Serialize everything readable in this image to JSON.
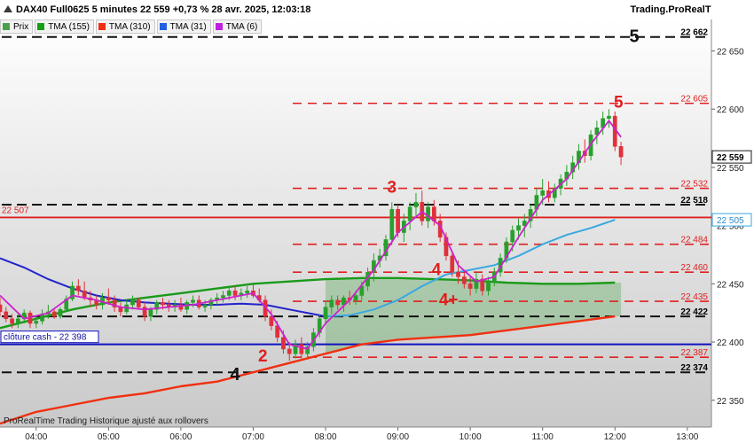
{
  "header": {
    "title": "DAX40 Full0625 5 minutes 22 559 +0,73 % 28 avr. 2025, 12:03:18",
    "brand": "Trading.ProRealTime.com"
  },
  "legend": [
    {
      "label": "Prix",
      "color": "#4aa04a"
    },
    {
      "label": "TMA (155)",
      "color": "#15a015"
    },
    {
      "label": "TMA (310)",
      "color": "#f03010"
    },
    {
      "label": "TMA (31)",
      "color": "#2060e0"
    },
    {
      "label": "TMA (6)",
      "color": "#c020e0"
    }
  ],
  "footer": "ProRealTime Trading  Historique ajusté aux rollovers",
  "colors": {
    "candle_up": "#27a02b",
    "candle_down": "#e0303a",
    "tma155": "#1a9a1a",
    "tma310": "#f03010",
    "tma31": "#2222cc",
    "tma31_late": "#3aa8e0",
    "tma6": "#cc22cc",
    "black_level": "#111111",
    "red_level": "#e02020",
    "cash_line": "#1010c0",
    "ref_line": "#e02020",
    "current_price_box": "#1a1a1a"
  },
  "chart_data": {
    "type": "candlestick",
    "instrument": "DAX40 Full0625",
    "timeframe": "5 minutes",
    "x_ticks": [
      "04:00",
      "05:00",
      "06:00",
      "07:00",
      "08:00",
      "09:00",
      "10:00",
      "11:00",
      "12:00",
      "13:00"
    ],
    "y_ticks": [
      22350,
      22400,
      22450,
      22500,
      22550,
      22600,
      22650
    ],
    "y_tick_labels": [
      "22 350",
      "22 400",
      "22 450",
      "22 500",
      "22 550",
      "22 600",
      "22 650"
    ],
    "ylim": [
      22327,
      22677
    ],
    "xlim": [
      "03:30",
      "13:20"
    ],
    "levels": [
      {
        "value": 22662,
        "label": "22 662",
        "color": "black",
        "style": "dashed"
      },
      {
        "value": 22605,
        "label": "22 605",
        "color": "red",
        "style": "dashed"
      },
      {
        "value": 22532,
        "label": "22 532",
        "color": "red",
        "style": "dashed"
      },
      {
        "value": 22518,
        "label": "22 518",
        "color": "black",
        "style": "dashed"
      },
      {
        "value": 22484,
        "label": "22 484",
        "color": "red",
        "style": "dashed"
      },
      {
        "value": 22460,
        "label": "22 460",
        "color": "red",
        "style": "dashed"
      },
      {
        "value": 22435,
        "label": "22 435",
        "color": "red",
        "style": "dashed"
      },
      {
        "value": 22422,
        "label": "22 422",
        "color": "black",
        "style": "dashed"
      },
      {
        "value": 22387,
        "label": "22 387",
        "color": "red",
        "style": "dashed"
      },
      {
        "value": 22374,
        "label": "22 374",
        "color": "black",
        "style": "dashed"
      }
    ],
    "reference_line": {
      "value": 22507,
      "label": "22 507"
    },
    "cash_close": {
      "value": 22398,
      "label": "clôture cash -  22 398"
    },
    "current_price": {
      "value": 22559,
      "label": "22 559"
    },
    "tma31_last": {
      "value": 22505,
      "label": "22 505"
    },
    "annotations": [
      {
        "text": "5",
        "time": "12:16",
        "price": 22662,
        "color": "black"
      },
      {
        "text": "5",
        "time": "12:03",
        "price": 22606,
        "color": "red"
      },
      {
        "text": "3",
        "time": "08:55",
        "price": 22533,
        "color": "red"
      },
      {
        "text": "4",
        "time": "09:32",
        "price": 22462,
        "color": "red"
      },
      {
        "text": "4+",
        "time": "09:42",
        "price": 22436,
        "color": "red"
      },
      {
        "text": "2",
        "time": "07:08",
        "price": 22388,
        "color": "red"
      },
      {
        "text": "4",
        "time": "06:45",
        "price": 22372,
        "color": "black"
      }
    ],
    "candles": [
      [
        "03:30",
        22432,
        22438,
        22422,
        22426
      ],
      [
        "03:35",
        22426,
        22430,
        22417,
        22420
      ],
      [
        "03:40",
        22420,
        22424,
        22412,
        22416
      ],
      [
        "03:45",
        22416,
        22424,
        22412,
        22420
      ],
      [
        "03:50",
        22420,
        22428,
        22416,
        22425
      ],
      [
        "03:55",
        22425,
        22427,
        22412,
        22416
      ],
      [
        "04:00",
        22416,
        22422,
        22412,
        22418
      ],
      [
        "04:05",
        22418,
        22428,
        22415,
        22424
      ],
      [
        "04:10",
        22424,
        22432,
        22420,
        22426
      ],
      [
        "04:15",
        22426,
        22428,
        22420,
        22422
      ],
      [
        "04:20",
        22422,
        22430,
        22420,
        22428
      ],
      [
        "04:25",
        22428,
        22440,
        22426,
        22437
      ],
      [
        "04:30",
        22437,
        22452,
        22435,
        22448
      ],
      [
        "04:35",
        22448,
        22454,
        22440,
        22444
      ],
      [
        "04:40",
        22444,
        22452,
        22436,
        22438
      ],
      [
        "04:45",
        22438,
        22444,
        22430,
        22436
      ],
      [
        "04:50",
        22436,
        22440,
        22428,
        22432
      ],
      [
        "04:55",
        22432,
        22442,
        22428,
        22438
      ],
      [
        "05:00",
        22438,
        22446,
        22432,
        22436
      ],
      [
        "05:05",
        22436,
        22440,
        22426,
        22430
      ],
      [
        "05:10",
        22430,
        22434,
        22422,
        22426
      ],
      [
        "05:15",
        22426,
        22436,
        22424,
        22432
      ],
      [
        "05:20",
        22432,
        22440,
        22428,
        22436
      ],
      [
        "05:25",
        22436,
        22438,
        22428,
        22430
      ],
      [
        "05:30",
        22430,
        22434,
        22418,
        22422
      ],
      [
        "05:35",
        22422,
        22430,
        22418,
        22428
      ],
      [
        "05:40",
        22428,
        22436,
        22424,
        22434
      ],
      [
        "05:45",
        22434,
        22438,
        22428,
        22432
      ],
      [
        "05:50",
        22432,
        22436,
        22426,
        22430
      ],
      [
        "05:55",
        22430,
        22436,
        22426,
        22432
      ],
      [
        "06:00",
        22432,
        22438,
        22426,
        22428
      ],
      [
        "06:05",
        22428,
        22436,
        22424,
        22434
      ],
      [
        "06:10",
        22434,
        22440,
        22430,
        22436
      ],
      [
        "06:15",
        22436,
        22440,
        22428,
        22430
      ],
      [
        "06:20",
        22430,
        22436,
        22426,
        22432
      ],
      [
        "06:25",
        22432,
        22438,
        22428,
        22436
      ],
      [
        "06:30",
        22436,
        22442,
        22432,
        22438
      ],
      [
        "06:35",
        22438,
        22444,
        22434,
        22440
      ],
      [
        "06:40",
        22440,
        22448,
        22436,
        22444
      ],
      [
        "06:45",
        22444,
        22448,
        22436,
        22440
      ],
      [
        "06:50",
        22440,
        22446,
        22436,
        22442
      ],
      [
        "06:55",
        22442,
        22448,
        22438,
        22444
      ],
      [
        "07:00",
        22444,
        22450,
        22438,
        22440
      ],
      [
        "07:05",
        22440,
        22446,
        22434,
        22436
      ],
      [
        "07:10",
        22436,
        22440,
        22418,
        22422
      ],
      [
        "07:15",
        22422,
        22428,
        22410,
        22414
      ],
      [
        "07:20",
        22414,
        22418,
        22400,
        22404
      ],
      [
        "07:25",
        22404,
        22410,
        22390,
        22394
      ],
      [
        "07:30",
        22394,
        22400,
        22384,
        22390
      ],
      [
        "07:35",
        22390,
        22402,
        22386,
        22398
      ],
      [
        "07:40",
        22398,
        22404,
        22386,
        22390
      ],
      [
        "07:45",
        22390,
        22400,
        22386,
        22396
      ],
      [
        "07:50",
        22396,
        22412,
        22392,
        22408
      ],
      [
        "07:55",
        22408,
        22424,
        22404,
        22420
      ],
      [
        "08:00",
        22420,
        22436,
        22416,
        22430
      ],
      [
        "08:05",
        22430,
        22440,
        22424,
        22436
      ],
      [
        "08:10",
        22436,
        22440,
        22428,
        22432
      ],
      [
        "08:15",
        22432,
        22440,
        22426,
        22438
      ],
      [
        "08:20",
        22438,
        22444,
        22432,
        22436
      ],
      [
        "08:25",
        22436,
        22444,
        22432,
        22440
      ],
      [
        "08:30",
        22440,
        22452,
        22436,
        22448
      ],
      [
        "08:35",
        22448,
        22464,
        22444,
        22460
      ],
      [
        "08:40",
        22460,
        22476,
        22452,
        22470
      ],
      [
        "08:45",
        22470,
        22480,
        22464,
        22474
      ],
      [
        "08:50",
        22474,
        22492,
        22470,
        22488
      ],
      [
        "08:55",
        22488,
        22520,
        22484,
        22514
      ],
      [
        "09:00",
        22514,
        22518,
        22490,
        22494
      ],
      [
        "09:05",
        22494,
        22510,
        22486,
        22504
      ],
      [
        "09:10",
        22504,
        22520,
        22496,
        22516
      ],
      [
        "09:15",
        22516,
        22528,
        22508,
        22520
      ],
      [
        "09:20",
        22520,
        22530,
        22500,
        22504
      ],
      [
        "09:25",
        22504,
        22520,
        22498,
        22516
      ],
      [
        "09:30",
        22516,
        22522,
        22500,
        22504
      ],
      [
        "09:35",
        22504,
        22510,
        22486,
        22490
      ],
      [
        "09:40",
        22490,
        22494,
        22470,
        22474
      ],
      [
        "09:45",
        22474,
        22478,
        22456,
        22460
      ],
      [
        "09:50",
        22460,
        22470,
        22450,
        22456
      ],
      [
        "09:55",
        22456,
        22462,
        22446,
        22450
      ],
      [
        "10:00",
        22450,
        22456,
        22440,
        22446
      ],
      [
        "10:05",
        22446,
        22460,
        22442,
        22454
      ],
      [
        "10:10",
        22454,
        22458,
        22440,
        22444
      ],
      [
        "10:15",
        22444,
        22456,
        22440,
        22452
      ],
      [
        "10:20",
        22452,
        22464,
        22448,
        22460
      ],
      [
        "10:25",
        22460,
        22476,
        22456,
        22472
      ],
      [
        "10:30",
        22472,
        22490,
        22468,
        22486
      ],
      [
        "10:35",
        22486,
        22500,
        22478,
        22496
      ],
      [
        "10:40",
        22496,
        22506,
        22488,
        22500
      ],
      [
        "10:45",
        22500,
        22510,
        22490,
        22504
      ],
      [
        "10:50",
        22504,
        22518,
        22498,
        22514
      ],
      [
        "10:55",
        22514,
        22532,
        22508,
        22526
      ],
      [
        "11:00",
        22526,
        22540,
        22518,
        22530
      ],
      [
        "11:05",
        22530,
        22538,
        22520,
        22524
      ],
      [
        "11:10",
        22524,
        22536,
        22520,
        22532
      ],
      [
        "11:15",
        22532,
        22544,
        22526,
        22540
      ],
      [
        "11:20",
        22540,
        22552,
        22534,
        22546
      ],
      [
        "11:25",
        22546,
        22560,
        22540,
        22554
      ],
      [
        "11:30",
        22554,
        22570,
        22548,
        22564
      ],
      [
        "11:35",
        22564,
        22574,
        22554,
        22560
      ],
      [
        "11:40",
        22560,
        22582,
        22556,
        22578
      ],
      [
        "11:45",
        22578,
        22590,
        22570,
        22584
      ],
      [
        "11:50",
        22584,
        22598,
        22578,
        22592
      ],
      [
        "11:55",
        22592,
        22600,
        22584,
        22594
      ],
      [
        "12:00",
        22594,
        22598,
        22564,
        22568
      ],
      [
        "12:05",
        22568,
        22572,
        22552,
        22559
      ]
    ],
    "tma6_points": [
      [
        "03:30",
        22440
      ],
      [
        "03:50",
        22420
      ],
      [
        "04:10",
        22425
      ],
      [
        "04:30",
        22440
      ],
      [
        "04:50",
        22436
      ],
      [
        "05:10",
        22430
      ],
      [
        "05:30",
        22428
      ],
      [
        "05:50",
        22430
      ],
      [
        "06:10",
        22432
      ],
      [
        "06:30",
        22436
      ],
      [
        "06:50",
        22440
      ],
      [
        "07:00",
        22442
      ],
      [
        "07:15",
        22424
      ],
      [
        "07:30",
        22398
      ],
      [
        "07:45",
        22394
      ],
      [
        "08:00",
        22416
      ],
      [
        "08:20",
        22436
      ],
      [
        "08:40",
        22462
      ],
      [
        "09:00",
        22494
      ],
      [
        "09:20",
        22512
      ],
      [
        "09:35",
        22500
      ],
      [
        "09:50",
        22466
      ],
      [
        "10:05",
        22452
      ],
      [
        "10:20",
        22456
      ],
      [
        "10:40",
        22490
      ],
      [
        "11:00",
        22522
      ],
      [
        "11:20",
        22540
      ],
      [
        "11:40",
        22570
      ],
      [
        "11:55",
        22590
      ],
      [
        "12:05",
        22576
      ]
    ],
    "tma31_points": [
      [
        "03:30",
        22472
      ],
      [
        "03:50",
        22464
      ],
      [
        "04:10",
        22454
      ],
      [
        "04:30",
        22446
      ],
      [
        "04:50",
        22440
      ],
      [
        "05:10",
        22436
      ],
      [
        "05:30",
        22434
      ],
      [
        "05:50",
        22433
      ],
      [
        "06:10",
        22432
      ],
      [
        "06:30",
        22432
      ],
      [
        "06:50",
        22433
      ],
      [
        "07:10",
        22432
      ],
      [
        "07:30",
        22428
      ],
      [
        "07:50",
        22424
      ],
      [
        "08:00",
        22422
      ],
      [
        "08:20",
        22423
      ],
      [
        "08:40",
        22428
      ],
      [
        "09:00",
        22436
      ],
      [
        "09:20",
        22448
      ],
      [
        "09:40",
        22458
      ],
      [
        "10:00",
        22462
      ],
      [
        "10:20",
        22466
      ],
      [
        "10:40",
        22474
      ],
      [
        "11:00",
        22484
      ],
      [
        "11:20",
        22492
      ],
      [
        "11:40",
        22498
      ],
      [
        "12:00",
        22505
      ]
    ],
    "tma155_points": [
      [
        "03:30",
        22412
      ],
      [
        "04:00",
        22420
      ],
      [
        "04:30",
        22428
      ],
      [
        "05:00",
        22434
      ],
      [
        "05:30",
        22438
      ],
      [
        "06:00",
        22442
      ],
      [
        "06:30",
        22446
      ],
      [
        "07:00",
        22450
      ],
      [
        "07:30",
        22452
      ],
      [
        "08:00",
        22454
      ],
      [
        "08:30",
        22455
      ],
      [
        "09:00",
        22455
      ],
      [
        "09:30",
        22454
      ],
      [
        "10:00",
        22453
      ],
      [
        "10:30",
        22451
      ],
      [
        "11:00",
        22450
      ],
      [
        "11:30",
        22450
      ],
      [
        "12:00",
        22451
      ]
    ],
    "tma310_points": [
      [
        "03:30",
        22330
      ],
      [
        "04:00",
        22340
      ],
      [
        "04:30",
        22346
      ],
      [
        "05:00",
        22352
      ],
      [
        "05:30",
        22356
      ],
      [
        "06:00",
        22362
      ],
      [
        "06:30",
        22366
      ],
      [
        "07:00",
        22374
      ],
      [
        "07:30",
        22382
      ],
      [
        "08:00",
        22390
      ],
      [
        "08:30",
        22398
      ],
      [
        "09:00",
        22402
      ],
      [
        "09:30",
        22404
      ],
      [
        "10:00",
        22406
      ],
      [
        "10:30",
        22410
      ],
      [
        "11:00",
        22414
      ],
      [
        "11:30",
        22418
      ],
      [
        "12:00",
        22422
      ]
    ]
  }
}
